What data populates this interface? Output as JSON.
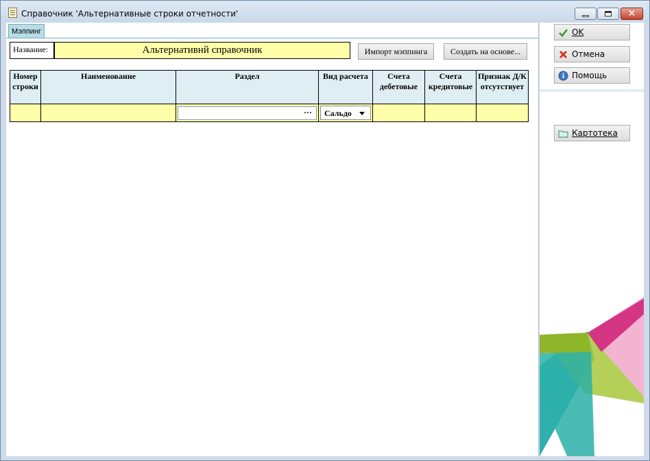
{
  "window": {
    "title": "Справочник 'Альтернативные строки отчетности'",
    "controls": {
      "minimize": "",
      "maximize": "",
      "close": "✕"
    }
  },
  "tabs": [
    {
      "label": "Мэппинг",
      "selected": true
    }
  ],
  "form": {
    "name_label": "Название:",
    "name_value": "Альтернативнй справочник",
    "import_button": "Импорт мэппинга",
    "create_button": "Создать на основе..."
  },
  "grid": {
    "columns": [
      {
        "label": "Номер строки"
      },
      {
        "label": "Наименование"
      },
      {
        "label": "Раздел"
      },
      {
        "label": "Вид расчета"
      },
      {
        "label": "Счета дебетовые"
      },
      {
        "label": "Счета кредитовые"
      },
      {
        "label": "Признак Д/К отсутствует"
      }
    ],
    "row": {
      "number": "",
      "name": "",
      "section": "",
      "section_button": "···",
      "calc_type": "Сальдо",
      "debit": "",
      "credit": "",
      "dk_flag": ""
    }
  },
  "sidebar": {
    "ok": "OK",
    "cancel": "Отмена",
    "help": "Помощь",
    "cardfile": "Картотека"
  },
  "colors": {
    "field_yellow": "#ffffaa",
    "header_blue": "#deeef3",
    "accent_magenta": "#d2287a",
    "accent_lime": "#a8c83c",
    "accent_teal": "#1aa6a6"
  }
}
